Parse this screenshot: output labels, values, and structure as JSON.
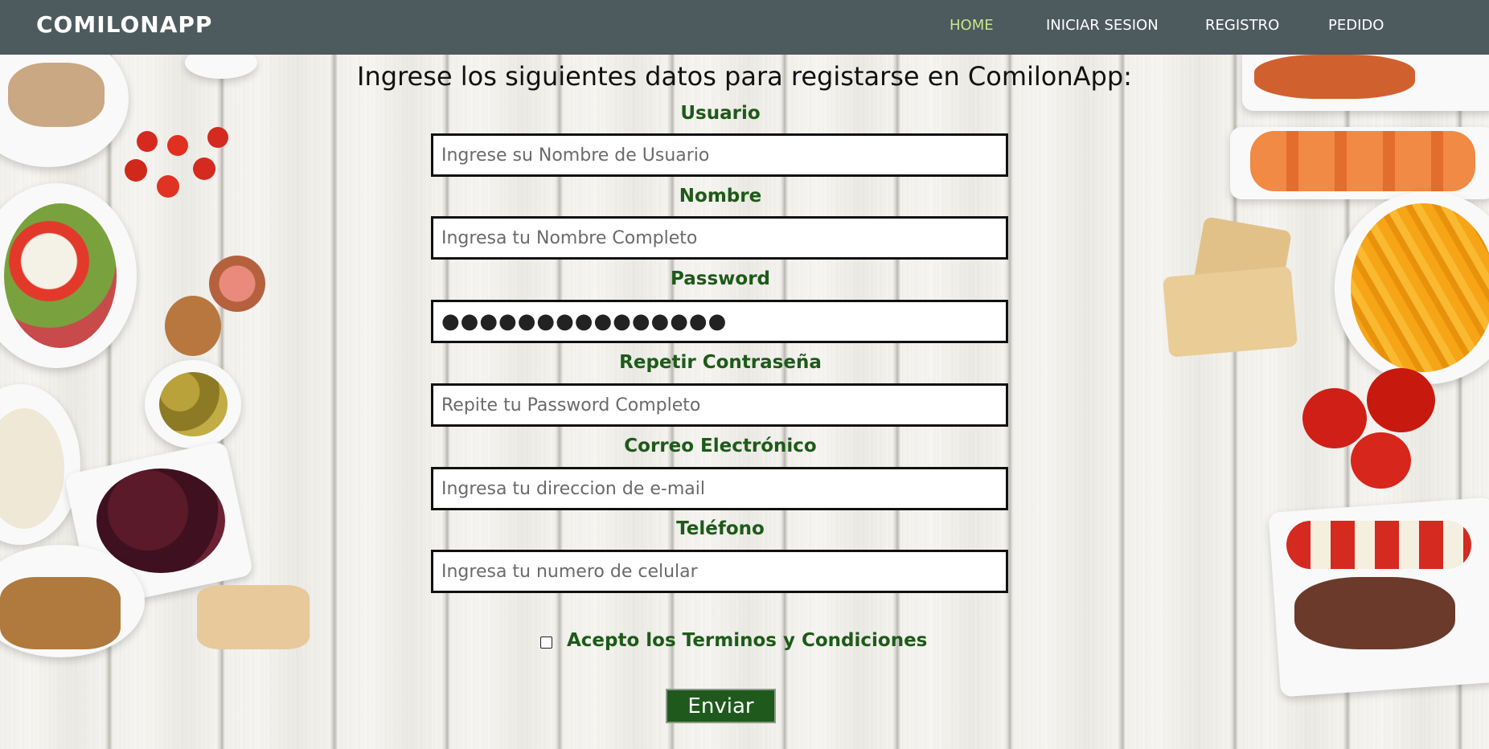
{
  "navbar": {
    "brand": "COMILONAPP",
    "links": [
      {
        "label": "HOME",
        "active": true
      },
      {
        "label": "INICIAR SESION",
        "active": false
      },
      {
        "label": "REGISTRO",
        "active": false
      },
      {
        "label": "PEDIDO",
        "active": false
      }
    ]
  },
  "form": {
    "heading": "Ingrese los siguientes datos para registarse en ComilonApp:",
    "fields": [
      {
        "label": "Usuario",
        "placeholder": "Ingrese su Nombre de Usuario",
        "value": ""
      },
      {
        "label": "Nombre",
        "placeholder": "Ingresa tu Nombre Completo",
        "value": ""
      },
      {
        "label": "Password",
        "placeholder": "",
        "value": "●●●●●●●●●●●●●●●"
      },
      {
        "label": "Repetir Contraseña",
        "placeholder": "Repite tu Password Completo",
        "value": ""
      },
      {
        "label": "Correo Electrónico",
        "placeholder": "Ingresa tu direccion de e-mail",
        "value": ""
      },
      {
        "label": "Teléfono",
        "placeholder": "Ingresa tu numero de celular",
        "value": ""
      }
    ],
    "terms_label": "Acepto los Terminos y Condiciones",
    "terms_checked": false,
    "submit_label": "Enviar"
  },
  "colors": {
    "navbar_bg": "#4d5a5e",
    "nav_active": "#c8e68a",
    "label_green": "#1e5a19",
    "button_bg": "#1f5a1c"
  }
}
